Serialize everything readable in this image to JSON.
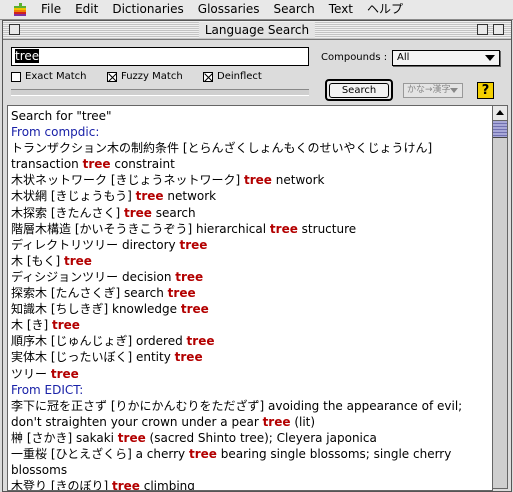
{
  "menubar": {
    "items": [
      "File",
      "Edit",
      "Dictionaries",
      "Glossaries",
      "Search",
      "Text",
      "ヘルプ"
    ]
  },
  "window": {
    "title": "Language Search"
  },
  "search": {
    "value": "tree",
    "compounds_label": "Compounds :",
    "compounds_value": "All",
    "options": [
      {
        "label": "Exact Match",
        "checked": false
      },
      {
        "label": "Fuzzy Match",
        "checked": true
      },
      {
        "label": "Deinflect",
        "checked": true
      }
    ],
    "button_label": "Search",
    "mode_label": "かな→漢字",
    "help_label": "?"
  },
  "results": {
    "lines": [
      {
        "type": "plain",
        "parts": [
          {
            "t": "Search for \"tree\""
          }
        ]
      },
      {
        "type": "header",
        "parts": [
          {
            "t": "From compdic:"
          }
        ]
      },
      {
        "type": "plain",
        "parts": [
          {
            "t": "トランザクション木の制約条件 [とらんざくしょんもくのせいやくじょうけん]"
          }
        ]
      },
      {
        "type": "plain",
        "parts": [
          {
            "t": "transaction "
          },
          {
            "t": "tree",
            "hl": true
          },
          {
            "t": " constraint"
          }
        ]
      },
      {
        "type": "plain",
        "parts": [
          {
            "t": "木状ネットワーク [きじょうネットワーク] "
          },
          {
            "t": "tree",
            "hl": true
          },
          {
            "t": " network"
          }
        ]
      },
      {
        "type": "plain",
        "parts": [
          {
            "t": "木状網 [きじょうもう] "
          },
          {
            "t": "tree",
            "hl": true
          },
          {
            "t": " network"
          }
        ]
      },
      {
        "type": "plain",
        "parts": [
          {
            "t": "木探索 [きたんさく] "
          },
          {
            "t": "tree",
            "hl": true
          },
          {
            "t": " search"
          }
        ]
      },
      {
        "type": "plain",
        "parts": [
          {
            "t": "階層木構造 [かいそうきこうぞう] hierarchical "
          },
          {
            "t": "tree",
            "hl": true
          },
          {
            "t": " structure"
          }
        ]
      },
      {
        "type": "plain",
        "parts": [
          {
            "t": "ディレクトリツリー directory "
          },
          {
            "t": "tree",
            "hl": true
          }
        ]
      },
      {
        "type": "plain",
        "parts": [
          {
            "t": "木 [もく] "
          },
          {
            "t": "tree",
            "hl": true
          }
        ]
      },
      {
        "type": "plain",
        "parts": [
          {
            "t": "ディシジョンツリー decision "
          },
          {
            "t": "tree",
            "hl": true
          }
        ]
      },
      {
        "type": "plain",
        "parts": [
          {
            "t": "探索木 [たんさくぎ] search "
          },
          {
            "t": "tree",
            "hl": true
          }
        ]
      },
      {
        "type": "plain",
        "parts": [
          {
            "t": "知識木 [ちしきぎ] knowledge "
          },
          {
            "t": "tree",
            "hl": true
          }
        ]
      },
      {
        "type": "plain",
        "parts": [
          {
            "t": "木 [き] "
          },
          {
            "t": "tree",
            "hl": true
          }
        ]
      },
      {
        "type": "plain",
        "parts": [
          {
            "t": "順序木 [じゅんじょぎ] ordered "
          },
          {
            "t": "tree",
            "hl": true
          }
        ]
      },
      {
        "type": "plain",
        "parts": [
          {
            "t": "実体木 [じったいぼく] entity "
          },
          {
            "t": "tree",
            "hl": true
          }
        ]
      },
      {
        "type": "plain",
        "parts": [
          {
            "t": "ツリー "
          },
          {
            "t": "tree",
            "hl": true
          }
        ]
      },
      {
        "type": "header",
        "parts": [
          {
            "t": "From EDICT:"
          }
        ]
      },
      {
        "type": "plain",
        "parts": [
          {
            "t": "李下に冠を正さず [りかにかんむりをただざず] avoiding the appearance of evil;"
          }
        ]
      },
      {
        "type": "plain",
        "parts": [
          {
            "t": "don't straighten your crown under a pear "
          },
          {
            "t": "tree",
            "hl": true
          },
          {
            "t": " (lit)"
          }
        ]
      },
      {
        "type": "plain",
        "parts": [
          {
            "t": "榊 [さかき] sakaki "
          },
          {
            "t": "tree",
            "hl": true
          },
          {
            "t": " (sacred Shinto tree); Cleyera japonica"
          }
        ]
      },
      {
        "type": "wrap",
        "parts": [
          {
            "t": "一重桜 [ひとえざくら] a cherry "
          },
          {
            "t": "tree",
            "hl": true
          },
          {
            "t": " bearing single blossoms; single cherry blossoms"
          }
        ]
      },
      {
        "type": "plain",
        "parts": [
          {
            "t": "木登り [きのぼり] "
          },
          {
            "t": "tree",
            "hl": true
          },
          {
            "t": " climbing"
          }
        ]
      }
    ]
  },
  "colors": {
    "highlight": "#b30000",
    "header": "#1a22a8",
    "help_bg": "#f4d000"
  },
  "icons": {
    "apple": "apple-logo-icon",
    "help": "help-icon",
    "scroll_up": "scroll-up-arrow-icon"
  }
}
